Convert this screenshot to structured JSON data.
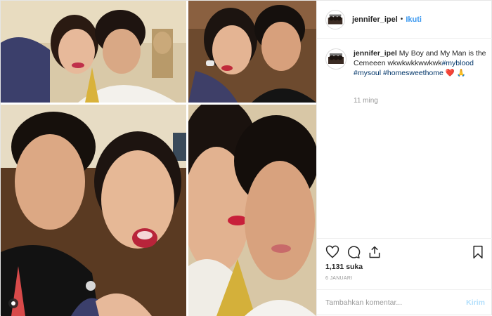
{
  "post": {
    "username": "jennifer_ipel",
    "separator": "•",
    "follow_label": "Ikuti",
    "caption": {
      "username": "jennifer_ipel",
      "text": "My Boy and My Man is the Cemeeen wkwkwkkwwkwk",
      "hashtags": [
        "#myblood",
        "#mysoul",
        "#homesweethome"
      ],
      "emoji_heart": "❤️",
      "emoji_pray": "🙏"
    },
    "time_ago": "11 ming",
    "likes": "1,131 suka",
    "date": "6 JANUARI",
    "comment": {
      "placeholder": "Tambahkan komentar...",
      "send_label": "Kirim"
    }
  },
  "icons": {
    "like": "heart-outline-icon",
    "comment": "comment-bubble-icon",
    "share": "share-upload-icon",
    "save": "bookmark-icon",
    "multi": "carousel-multi-photo-icon"
  },
  "colors": {
    "link_blue": "#3897f0",
    "hashtag_blue": "#003569",
    "heart_red": "#ed4956",
    "muted_gray": "#999999",
    "send_disabled": "#b2dffc"
  }
}
